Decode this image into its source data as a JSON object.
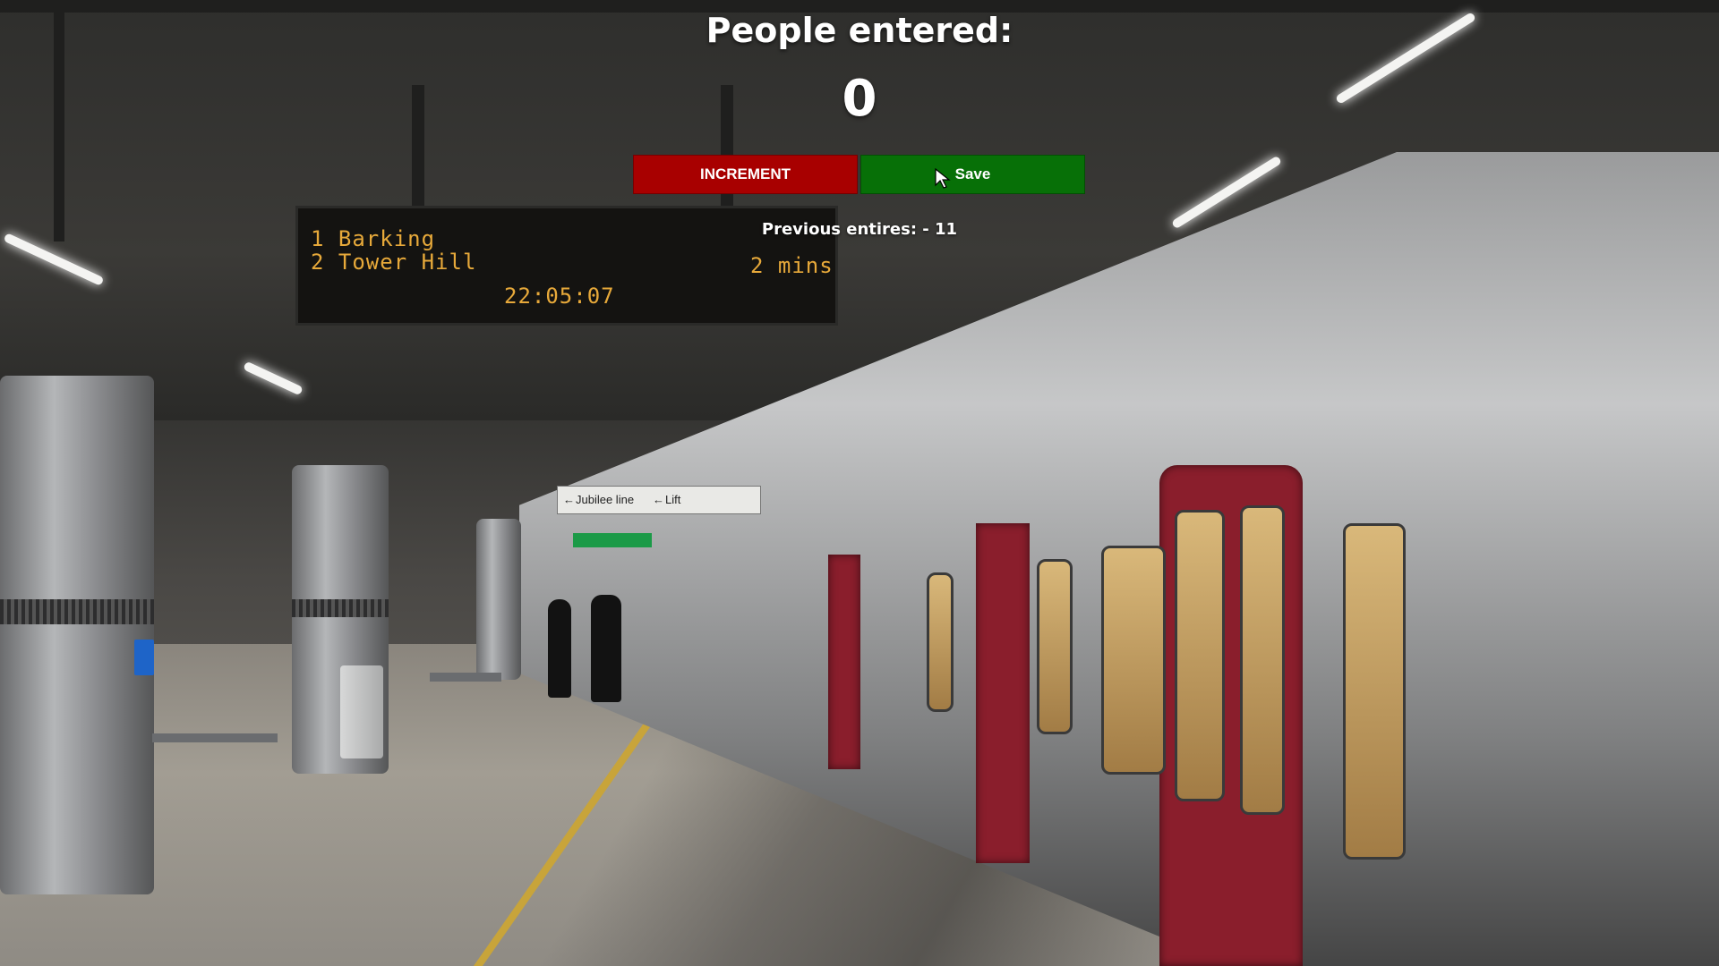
{
  "counter": {
    "heading": "People entered:",
    "value": "0",
    "previous_entries_text": "Previous entires: - 11"
  },
  "buttons": {
    "increment_label": "INCREMENT",
    "save_label": "Save"
  },
  "colors": {
    "increment_bg": "#a80000",
    "save_bg": "#077007",
    "text": "#ffffff"
  },
  "background": {
    "departure_board": {
      "line1": "1 Barking",
      "line2": "2 Tower Hill",
      "due": "2 mins",
      "clock": "22:05:07"
    },
    "sign": {
      "jubilee": "Jubilee line",
      "lift": "Lift"
    }
  },
  "cursor": "pointer-arrow-icon"
}
